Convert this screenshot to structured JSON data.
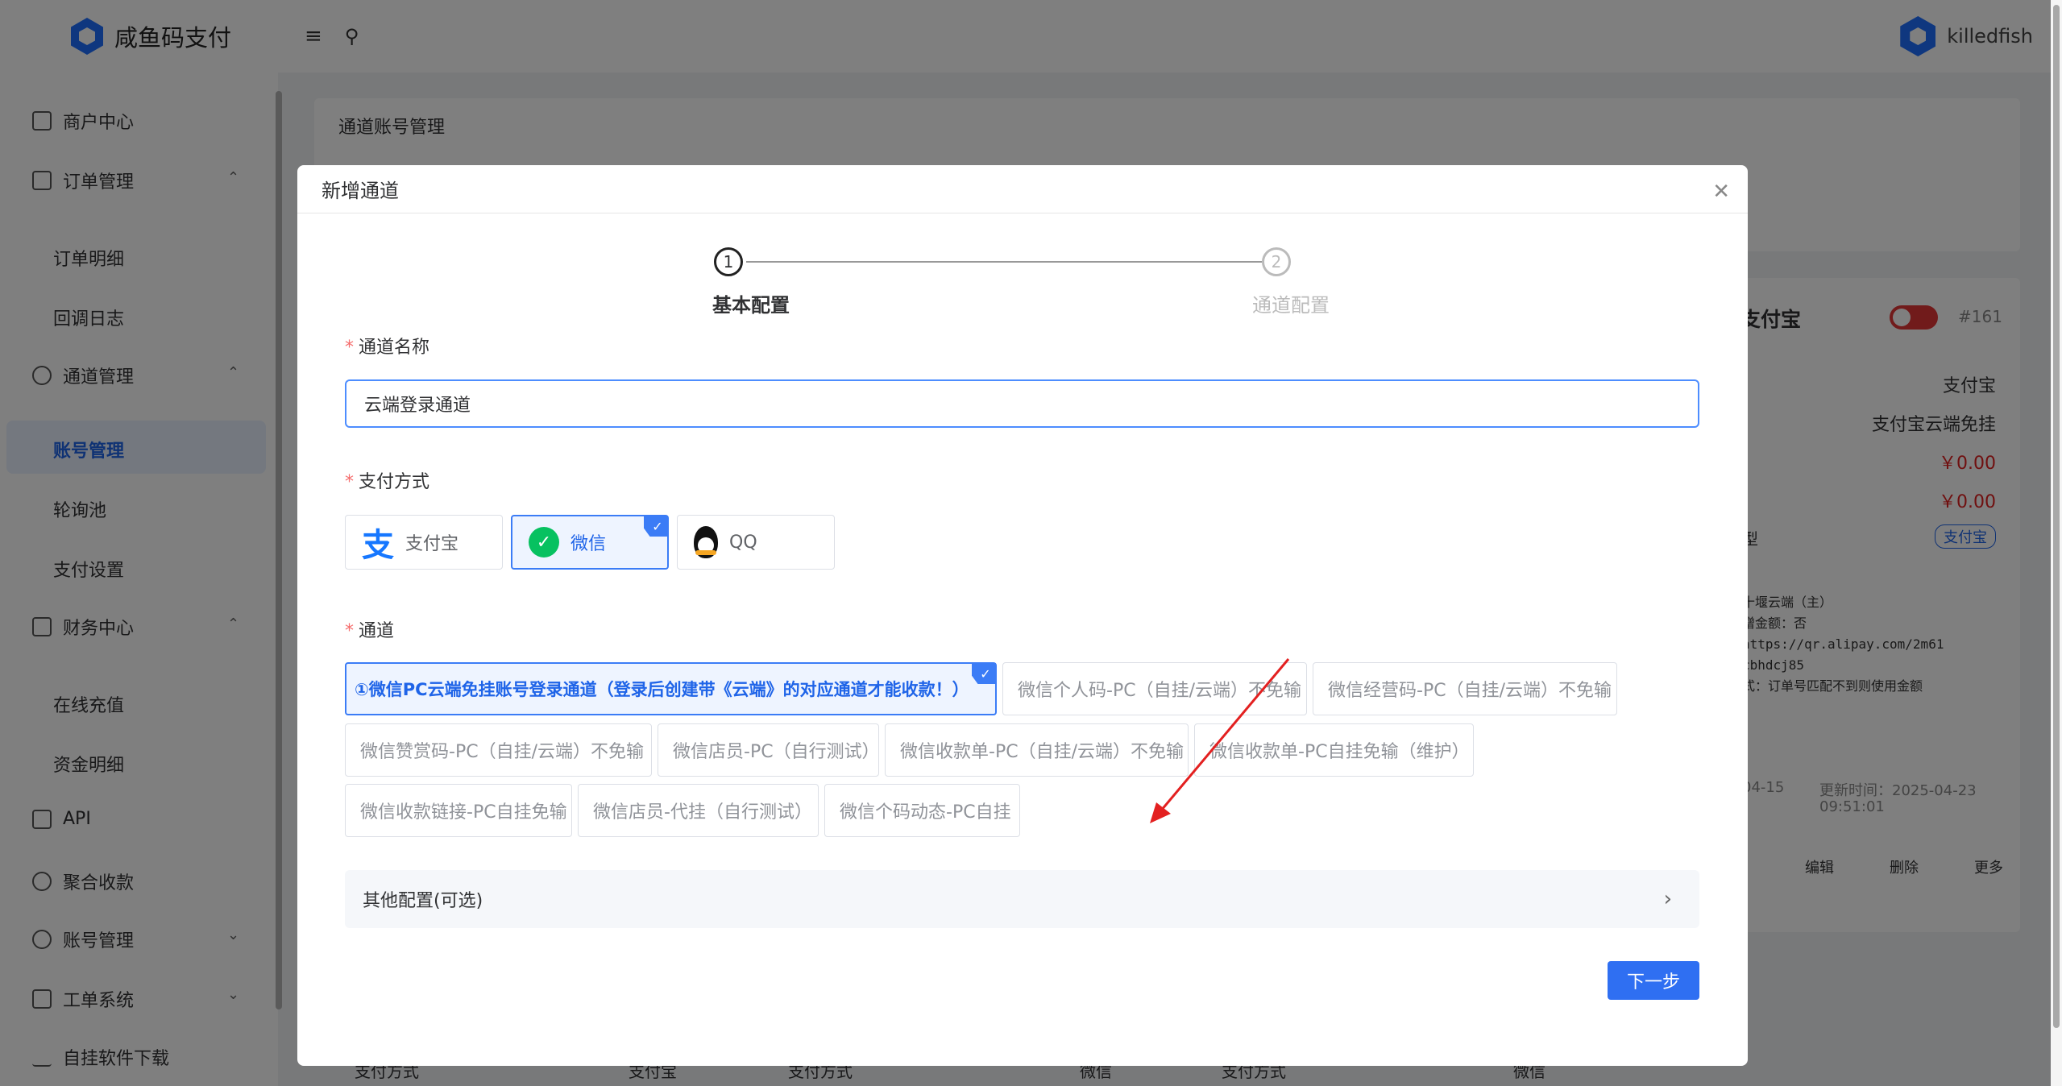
{
  "app": {
    "name": "咸鱼码支付",
    "user": "killedfish"
  },
  "sidebar": {
    "items": [
      {
        "label": "商户中心"
      },
      {
        "label": "订单管理"
      },
      {
        "label": "订单明细"
      },
      {
        "label": "回调日志"
      },
      {
        "label": "通道管理"
      },
      {
        "label": "账号管理"
      },
      {
        "label": "轮询池"
      },
      {
        "label": "支付设置"
      },
      {
        "label": "财务中心"
      },
      {
        "label": "在线充值"
      },
      {
        "label": "资金明细"
      },
      {
        "label": "API"
      },
      {
        "label": "聚合收款"
      },
      {
        "label": "账号管理"
      },
      {
        "label": "工单系统"
      },
      {
        "label": "自挂软件下载"
      }
    ]
  },
  "background": {
    "page_title": "通道账号管理",
    "card_title": "支付宝",
    "card_id": "#161",
    "rows": [
      "支付宝",
      "支付宝云端免挂",
      "￥0.00",
      "￥0.00"
    ],
    "tag": "支付宝",
    "log_lines": [
      "十堰云端（主）",
      "增金额：否",
      "https://qr.alipay.com/2m61",
      "cbhdcj85",
      "式：订单号匹配不到则使用金额"
    ],
    "date_left": "04-15",
    "update_label": "更新时间：2025-04-23",
    "update_time": "09:51:01",
    "actions": [
      "编辑",
      "删除",
      "更多"
    ],
    "bottom_texts": [
      "支付方式",
      "支付宝",
      "支付方式",
      "微信",
      "支付方式",
      "微信"
    ],
    "partial_label": "型"
  },
  "dialog": {
    "title": "新增通道",
    "steps": [
      {
        "num": "1",
        "label": "基本配置"
      },
      {
        "num": "2",
        "label": "通道配置"
      }
    ],
    "name_label": "通道名称",
    "name_value": "云端登录通道",
    "pay_label": "支付方式",
    "pay_methods": [
      {
        "label": "支付宝"
      },
      {
        "label": "微信"
      },
      {
        "label": "QQ"
      }
    ],
    "channel_label": "通道",
    "channels": [
      "①微信PC云端免挂账号登录通道（登录后创建带《云端》的对应通道才能收款！）",
      "微信个人码-PC（自挂/云端）不免输",
      "微信经营码-PC（自挂/云端）不免输",
      "微信赞赏码-PC（自挂/云端）不免输",
      "微信店员-PC（自行测试）",
      "微信收款单-PC（自挂/云端）不免输",
      "微信收款单-PC自挂免输（维护）",
      "微信收款链接-PC自挂免输",
      "微信店员-代挂（自行测试）",
      "微信个码动态-PC自挂"
    ],
    "other_config": "其他配置(可选)",
    "next_button": "下一步"
  },
  "colors": {
    "primary": "#2f6ff2",
    "required": "#f56c6c",
    "amount": "#e02020"
  },
  "icons": [
    "menu-icon",
    "search-icon",
    "close-icon",
    "alipay-icon",
    "wechat-icon",
    "qq-icon",
    "check-icon",
    "chevron-right-icon"
  ]
}
